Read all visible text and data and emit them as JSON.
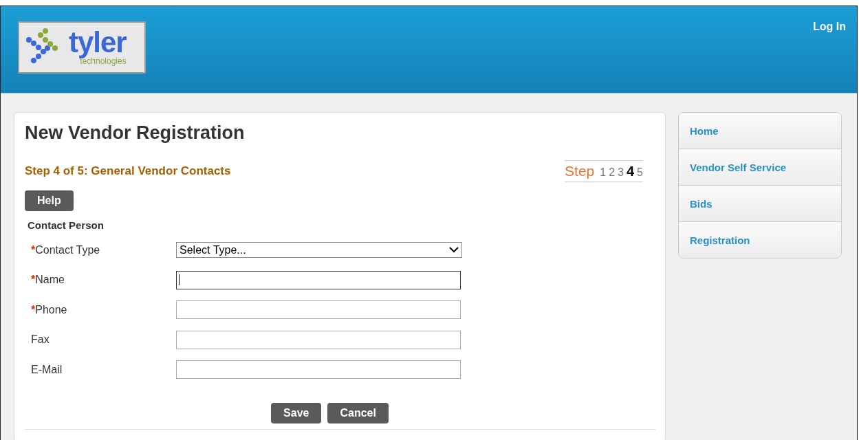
{
  "header": {
    "logo": {
      "name": "tyler",
      "tagline": "technologies"
    },
    "login_link": "Log In"
  },
  "title": "New Vendor Registration",
  "step_heading": "Step 4 of 5: General Vendor Contacts",
  "step_indicator": {
    "label": "Step",
    "steps": [
      {
        "label": "1",
        "selected": false
      },
      {
        "label": "2",
        "selected": false
      },
      {
        "label": "3",
        "selected": false
      },
      {
        "label": "4",
        "selected": true
      },
      {
        "label": "5",
        "selected": false
      }
    ]
  },
  "help_button": "Help",
  "section_title": "Contact Person",
  "fields": [
    {
      "kind": "select",
      "label": "Contact Type",
      "required": true,
      "value": "Select Type...",
      "focused": false
    },
    {
      "kind": "text",
      "label": "Name",
      "required": true,
      "focused": true
    },
    {
      "kind": "text",
      "label": "Phone",
      "required": true,
      "focused": false
    },
    {
      "kind": "text",
      "label": "Fax",
      "required": false,
      "focused": false
    },
    {
      "kind": "text",
      "label": "E-Mail",
      "required": false,
      "focused": false
    }
  ],
  "buttons": [
    "Save",
    "Cancel"
  ],
  "required_mark": "*",
  "sidebar": {
    "items": [
      "Home",
      "Vendor Self Service",
      "Bids",
      "Registration"
    ]
  }
}
